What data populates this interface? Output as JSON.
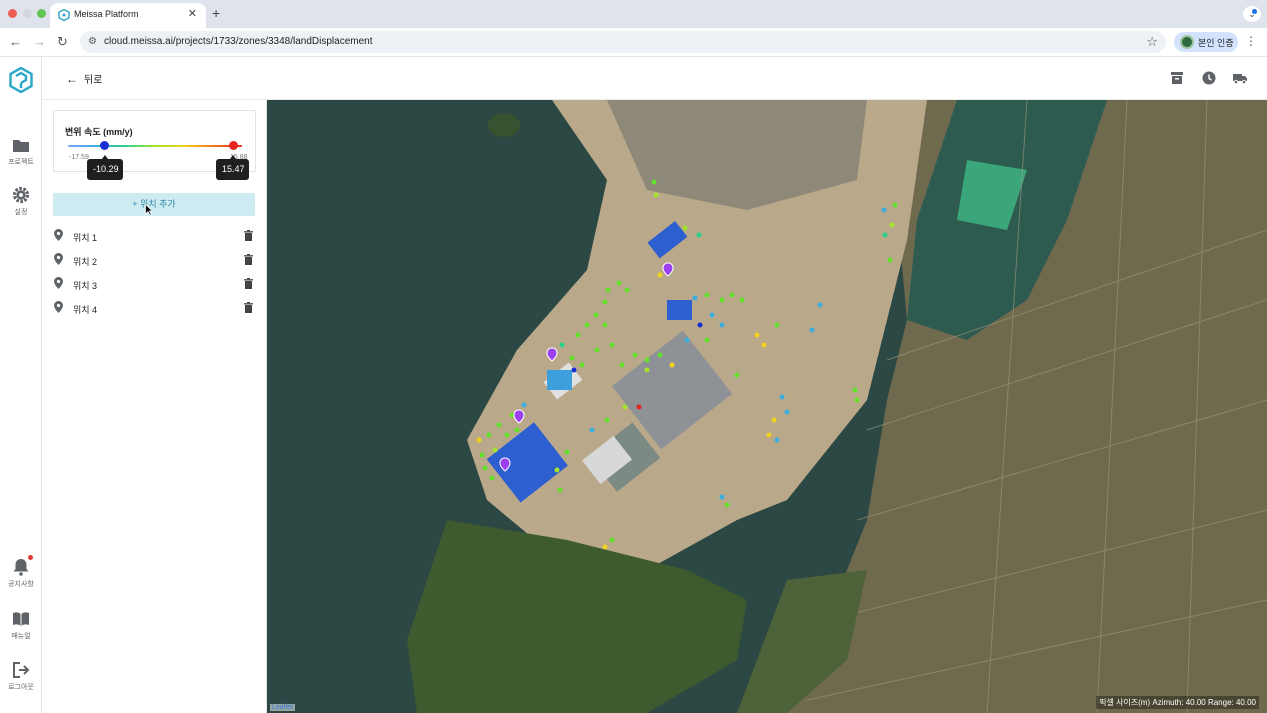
{
  "browser": {
    "tab_title": "Meissa Platform",
    "tab_close": "✕",
    "new_tab": "+",
    "url": "cloud.meissa.ai/projects/1733/zones/3348/landDisplacement",
    "profile_label": "본인 인증"
  },
  "rail": {
    "projects_label": "프로젝트",
    "settings_label": "설정",
    "notices_label": "공지사항",
    "manual_label": "매뉴얼",
    "logout_label": "로그아웃"
  },
  "header": {
    "back_label": "뒤로"
  },
  "legend": {
    "title": "변위 속도 (mm/y)",
    "min_label": "-17.59",
    "max_label": "15.88",
    "low_value": "-10.29",
    "high_value": "15.47",
    "gradient_colors": [
      "#7aa7ff",
      "#3caee0",
      "#2bd38a",
      "#a4e22b",
      "#f0d21a",
      "#f27b1e",
      "#e5261f"
    ]
  },
  "panel": {
    "add_button_label": "+ 위치 추가",
    "locations": [
      {
        "label": "위치 1"
      },
      {
        "label": "위치 2"
      },
      {
        "label": "위치 3"
      },
      {
        "label": "위치 4"
      }
    ]
  },
  "map": {
    "attribution": "Leaflet",
    "info": "픽셀 사이즈(m) Azimuth: 40.00 Range: 40.00"
  }
}
